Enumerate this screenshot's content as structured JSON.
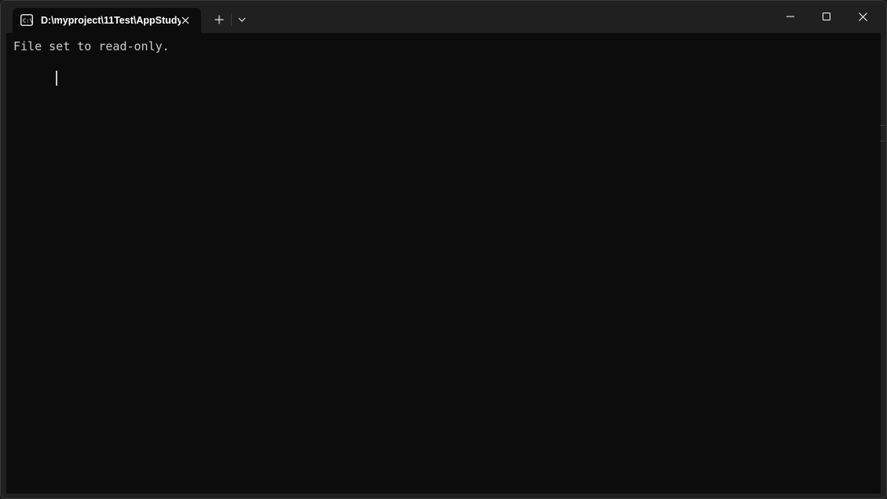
{
  "tab": {
    "title": "D:\\myproject\\11Test\\AppStudy",
    "icon": "console-icon"
  },
  "toolbar": {
    "new_tab_icon": "plus-icon",
    "dropdown_icon": "chevron-down-icon"
  },
  "window_controls": {
    "minimize_icon": "minimize-icon",
    "maximize_icon": "maximize-icon",
    "close_icon": "close-icon"
  },
  "terminal": {
    "lines": [
      "File set to read-only."
    ]
  },
  "colors": {
    "background": "#0c0c0c",
    "chrome": "#202020",
    "text": "#cccccc"
  }
}
